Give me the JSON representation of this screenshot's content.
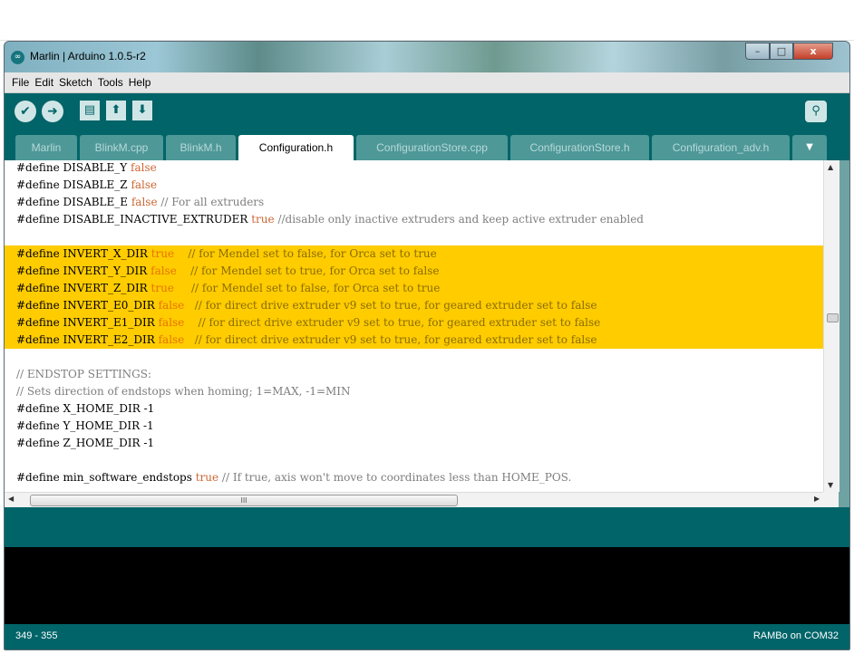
{
  "window": {
    "title": "Marlin | Arduino 1.0.5-r2",
    "app_icon": "infinity-icon",
    "minimize_label": "–",
    "maximize_label": "□",
    "close_label": "x"
  },
  "menu": [
    "File",
    "Edit",
    "Sketch",
    "Tools",
    "Help"
  ],
  "toolbar": {
    "verify_icon": "✔",
    "upload_icon": "➜",
    "new_icon": "▤",
    "open_icon": "⬆",
    "save_icon": "⬇",
    "serial_icon": "⚲"
  },
  "tabs": [
    {
      "label": "Marlin"
    },
    {
      "label": "BlinkM.cpp"
    },
    {
      "label": "BlinkM.h"
    },
    {
      "label": "Configuration.h",
      "active": true
    },
    {
      "label": "ConfigurationStore.cpp"
    },
    {
      "label": "ConfigurationStore.h"
    },
    {
      "label": "Configuration_adv.h"
    }
  ],
  "tab_menu_label": "▼",
  "code_lines": [
    {
      "hl": false,
      "parts": [
        [
          "#define DISABLE_Y ",
          ""
        ],
        [
          "false",
          "kw"
        ]
      ]
    },
    {
      "hl": false,
      "parts": [
        [
          "#define DISABLE_Z ",
          ""
        ],
        [
          "false",
          "kw"
        ]
      ]
    },
    {
      "hl": false,
      "parts": [
        [
          "#define DISABLE_E ",
          ""
        ],
        [
          "false",
          "kw"
        ],
        [
          " // For all extruders",
          "cm"
        ]
      ]
    },
    {
      "hl": false,
      "parts": [
        [
          "#define DISABLE_INACTIVE_EXTRUDER ",
          ""
        ],
        [
          "true",
          "kw"
        ],
        [
          " //disable only inactive extruders and keep active extruder enabled",
          "cm"
        ]
      ]
    },
    {
      "hl": false,
      "parts": []
    },
    {
      "hl": true,
      "parts": [
        [
          "#define INVERT_X_DIR ",
          ""
        ],
        [
          "true",
          "kw"
        ],
        [
          "    // for Mendel set to false, for Orca set to true",
          "cm"
        ]
      ]
    },
    {
      "hl": true,
      "parts": [
        [
          "#define INVERT_Y_DIR ",
          ""
        ],
        [
          "false",
          "kw"
        ],
        [
          "    // for Mendel set to true, for Orca set to false",
          "cm"
        ]
      ]
    },
    {
      "hl": true,
      "parts": [
        [
          "#define INVERT_Z_DIR ",
          ""
        ],
        [
          "true",
          "kw"
        ],
        [
          "     // for Mendel set to false, for Orca set to true",
          "cm"
        ]
      ]
    },
    {
      "hl": true,
      "parts": [
        [
          "#define INVERT_E0_DIR ",
          ""
        ],
        [
          "false",
          "kw"
        ],
        [
          "   // for direct drive extruder v9 set to true, for geared extruder set to false",
          "cm"
        ]
      ]
    },
    {
      "hl": true,
      "parts": [
        [
          "#define INVERT_E1_DIR ",
          ""
        ],
        [
          "false",
          "kw"
        ],
        [
          "    // for direct drive extruder v9 set to true, for geared extruder set to false",
          "cm"
        ]
      ]
    },
    {
      "hl": true,
      "parts": [
        [
          "#define INVERT_E2_DIR ",
          ""
        ],
        [
          "false",
          "kw"
        ],
        [
          "   // for direct drive extruder v9 set to true, for geared extruder set to false",
          "cm"
        ]
      ]
    },
    {
      "hl": false,
      "parts": []
    },
    {
      "hl": false,
      "parts": [
        [
          "// ENDSTOP SETTINGS:",
          "cm"
        ]
      ]
    },
    {
      "hl": false,
      "parts": [
        [
          "// Sets direction of endstops when homing; 1=MAX, -1=MIN",
          "cm"
        ]
      ]
    },
    {
      "hl": false,
      "parts": [
        [
          "#define X_HOME_DIR -1",
          ""
        ]
      ]
    },
    {
      "hl": false,
      "parts": [
        [
          "#define Y_HOME_DIR -1",
          ""
        ]
      ]
    },
    {
      "hl": false,
      "parts": [
        [
          "#define Z_HOME_DIR -1",
          ""
        ]
      ]
    },
    {
      "hl": false,
      "parts": []
    },
    {
      "hl": false,
      "parts": [
        [
          "#define min_software_endstops ",
          ""
        ],
        [
          "true",
          "kw"
        ],
        [
          " // If true, axis won't move to coordinates less than HOME_POS.",
          "cm"
        ]
      ]
    }
  ],
  "scrollbar": {
    "h_thumb_label": "III",
    "up": "▲",
    "down": "▼",
    "left": "◀",
    "right": "▶"
  },
  "status": {
    "line_range": "349 - 355",
    "board_port": "RAMBo on COM32"
  }
}
